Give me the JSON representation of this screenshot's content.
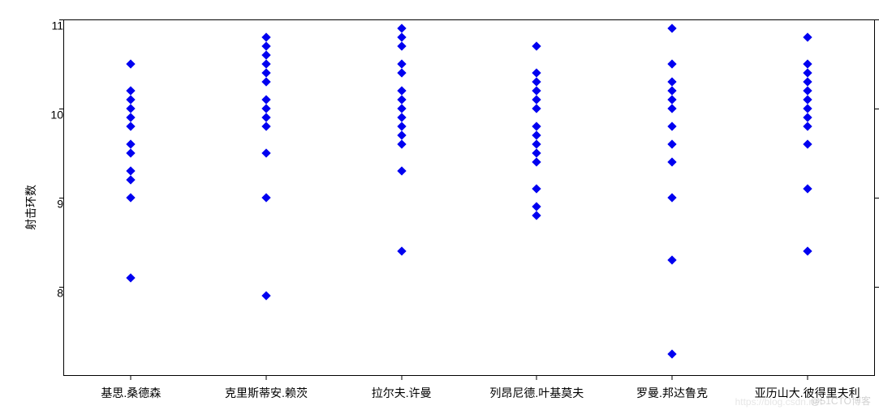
{
  "chart_data": {
    "type": "scatter",
    "ylabel": "射击环数",
    "xlabel": "",
    "ylim": [
      7.0,
      11.0
    ],
    "y_ticks": [
      8,
      9,
      10,
      11
    ],
    "categories": [
      "基思.桑德森",
      "克里斯蒂安.赖茨",
      "拉尔夫.许曼",
      "列昂尼德.叶基莫夫",
      "罗曼.邦达鲁克",
      "亚历山大.彼得里夫利"
    ],
    "series": [
      {
        "name": "基思.桑德森",
        "values": [
          8.1,
          9.0,
          9.2,
          9.3,
          9.5,
          9.6,
          9.8,
          9.9,
          10.0,
          10.1,
          10.2,
          10.5
        ]
      },
      {
        "name": "克里斯蒂安.赖茨",
        "values": [
          7.9,
          9.0,
          9.5,
          9.8,
          9.9,
          10.0,
          10.1,
          10.3,
          10.4,
          10.5,
          10.6,
          10.7,
          10.8
        ]
      },
      {
        "name": "拉尔夫.许曼",
        "values": [
          8.4,
          9.3,
          9.6,
          9.7,
          9.8,
          9.9,
          10.0,
          10.1,
          10.2,
          10.4,
          10.5,
          10.7,
          10.8,
          10.9
        ]
      },
      {
        "name": "列昂尼德.叶基莫夫",
        "values": [
          8.8,
          8.9,
          9.1,
          9.4,
          9.5,
          9.6,
          9.7,
          9.8,
          10.0,
          10.1,
          10.2,
          10.3,
          10.4,
          10.7
        ]
      },
      {
        "name": "罗曼.邦达鲁克",
        "values": [
          7.25,
          8.3,
          9.0,
          9.4,
          9.6,
          9.8,
          10.0,
          10.1,
          10.2,
          10.3,
          10.5,
          10.9
        ]
      },
      {
        "name": "亚历山大.彼得里夫利",
        "values": [
          8.4,
          9.1,
          9.6,
          9.8,
          9.9,
          10.0,
          10.1,
          10.2,
          10.3,
          10.4,
          10.5,
          10.8
        ]
      }
    ]
  },
  "watermark": "@51CTO博客",
  "watermark2": "https://blog.csdn.net"
}
